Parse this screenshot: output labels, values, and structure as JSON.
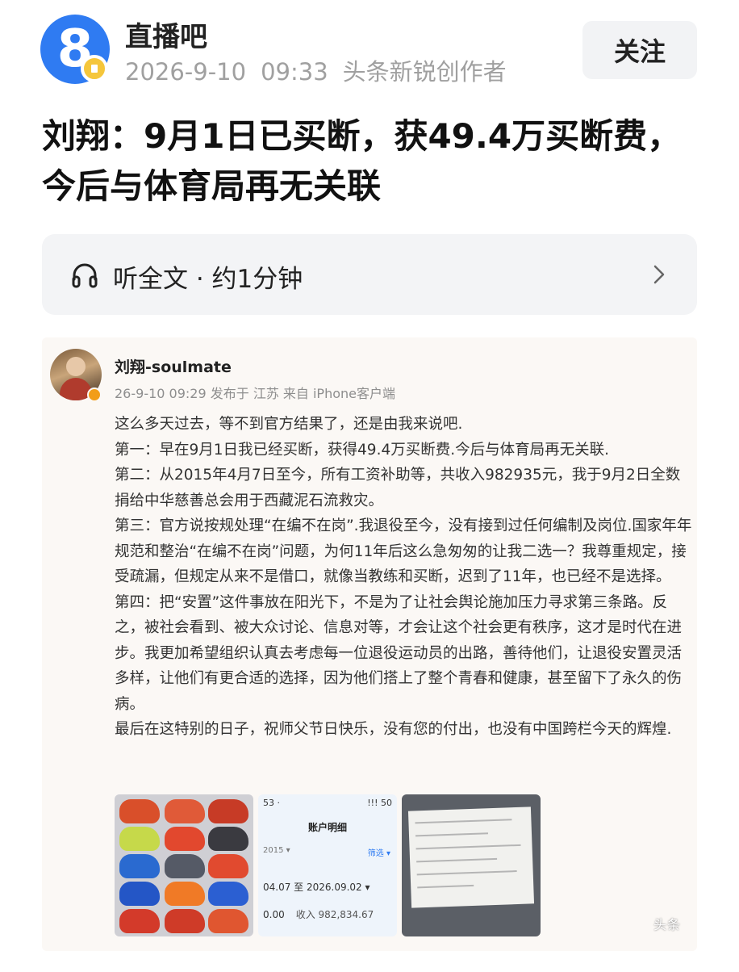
{
  "header": {
    "avatar_label": "8",
    "author_name": "直播吧",
    "date": "2026-9-10",
    "time": "09:33",
    "author_tag": "头条新锐创作者",
    "follow_label": "关注"
  },
  "article": {
    "title": "刘翔：9月1日已买断，获49.4万买断费，今后与体育局再无关联"
  },
  "listen": {
    "label": "听全文 · 约1分钟",
    "icon": "headphone-icon"
  },
  "post": {
    "username": "刘翔-soulmate",
    "meta": "26-9-10 09:29  发布于 江苏  来自 iPhone客户端",
    "paragraphs": [
      "这么多天过去，等不到官方结果了，还是由我来说吧.",
      "第一：早在9月1日我已经买断，获得49.4万买断费.今后与体育局再无关联.",
      "第二：从2015年4月7日至今，所有工资补助等，共收入982935元，我于9月2日全数捐给中华慈善总会用于西藏泥石流救灾。",
      "第三：官方说按规处理“在编不在岗”.我退役至今，没有接到过任何编制及岗位.国家年年规范和整治“在编不在岗”问题，为何11年后这么急匆匆的让我二选一？我尊重规定，接受疏漏，但规定从来不是借口，就像当教练和买断，迟到了11年，也已经不是选择。",
      "第四：把“安置”这件事放在阳光下，不是为了让社会舆论施加压力寻求第三条路。反之，被社会看到、被大众讨论、信息对等，才会让这个社会更有秩序，这才是时代在进步。我更加希望组织认真去考虑每一位退役运动员的出路，善待他们，让退役安置灵活多样，让他们有更合适的选择，因为他们搭上了整个青春和健康，甚至留下了永久的伤病。",
      "最后在这特别的日子，祝师父节日快乐，没有您的付出，也没有中国跨栏今天的辉煌."
    ],
    "images": {
      "account": {
        "status_left": "53 ·",
        "status_right": "!!! 50",
        "title": "账户明细",
        "row_left": "2015 ▾",
        "row_right": "筛选 ▾",
        "range": "04.07 至 2026.09.02 ▾",
        "total_left": "0.00",
        "total_right": "收入 982,834.67"
      },
      "watermark": "头条"
    }
  }
}
